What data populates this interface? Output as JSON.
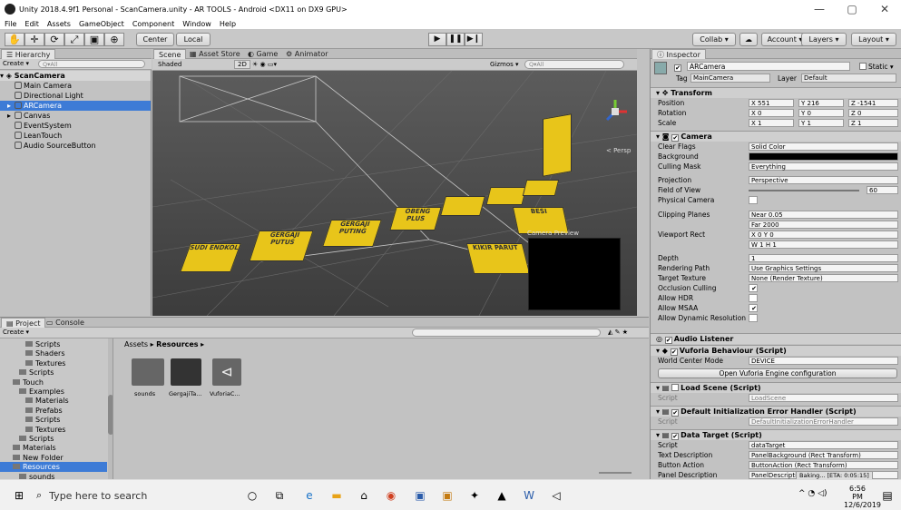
{
  "window": {
    "title": "Unity 2018.4.9f1 Personal - ScanCamera.unity - AR TOOLS - Android <DX11 on DX9 GPU>",
    "min": "—",
    "max": "▢",
    "close": "✕"
  },
  "menu": [
    "File",
    "Edit",
    "Assets",
    "GameObject",
    "Component",
    "Window",
    "Help"
  ],
  "toolbar": {
    "center": "Center",
    "local": "Local",
    "collab": "Collab ▾",
    "account": "Account ▾",
    "layers": "Layers ▾",
    "layout": "Layout ▾"
  },
  "hierarchy": {
    "tab": "Hierarchy",
    "create": "Create ▾",
    "search_placeholder": "Q▾All",
    "scene": "ScanCamera",
    "items": [
      {
        "label": "Main Camera",
        "indent": 2,
        "selected": false,
        "arrow": ""
      },
      {
        "label": "Directional Light",
        "indent": 2,
        "selected": false,
        "arrow": ""
      },
      {
        "label": "ARCamera",
        "indent": 2,
        "selected": true,
        "arrow": "▸"
      },
      {
        "label": "Canvas",
        "indent": 2,
        "selected": false,
        "arrow": "▸"
      },
      {
        "label": "EventSystem",
        "indent": 2,
        "selected": false,
        "arrow": ""
      },
      {
        "label": "LeanTouch",
        "indent": 2,
        "selected": false,
        "arrow": ""
      },
      {
        "label": "Audio SourceButton",
        "indent": 2,
        "selected": false,
        "arrow": ""
      }
    ]
  },
  "scene": {
    "tabs": [
      "Scene",
      "Asset Store",
      "Game",
      "Animator"
    ],
    "shaded": "Shaded",
    "mode2d": "2D",
    "gizmos": "Gizmos ▾",
    "search_placeholder": "Q▾All",
    "persp": "< Persp",
    "camera_preview": "Camera Preview",
    "cards": [
      "GERGAJI PUTUS",
      "GERGAJI PUTING",
      "OBENG PLUS",
      "KIKIR PARUT",
      "BESI",
      "SUDI ENDKOL"
    ]
  },
  "inspector": {
    "tab": "Inspector",
    "object_name": "ARCamera",
    "static": "Static ▾",
    "tag_label": "Tag",
    "tag": "MainCamera",
    "layer_label": "Layer",
    "layer": "Default",
    "transform": {
      "title": "Transform",
      "position": {
        "label": "Position",
        "x": "551",
        "y": "216",
        "z": "-1541"
      },
      "rotation": {
        "label": "Rotation",
        "x": "0",
        "y": "0",
        "z": "0"
      },
      "scale": {
        "label": "Scale",
        "x": "1",
        "y": "1",
        "z": "1"
      }
    },
    "camera": {
      "title": "Camera",
      "rows": [
        {
          "label": "Clear Flags",
          "value": "Solid Color"
        },
        {
          "label": "Background",
          "value": ""
        },
        {
          "label": "Culling Mask",
          "value": "Everything"
        },
        {
          "label": "Projection",
          "value": "Perspective"
        },
        {
          "label": "Field of View",
          "value": "60"
        },
        {
          "label": "Physical Camera",
          "value": ""
        },
        {
          "label": "Clipping Planes",
          "value": "Near  0.05"
        },
        {
          "label": "",
          "value": "Far   2000"
        },
        {
          "label": "Viewport Rect",
          "value": "X 0       Y 0"
        },
        {
          "label": "",
          "value": "W 1       H 1"
        },
        {
          "label": "Depth",
          "value": "1"
        },
        {
          "label": "Rendering Path",
          "value": "Use Graphics Settings"
        },
        {
          "label": "Target Texture",
          "value": "None (Render Texture)"
        },
        {
          "label": "Occlusion Culling",
          "value": "✔"
        },
        {
          "label": "Allow HDR",
          "value": ""
        },
        {
          "label": "Allow MSAA",
          "value": "✔"
        },
        {
          "label": "Allow Dynamic Resolution",
          "value": ""
        }
      ]
    },
    "audio_listener": "Audio Listener",
    "vuforia": {
      "title": "Vuforia Behaviour (Script)",
      "world_center_label": "World Center Mode",
      "world_center": "DEVICE",
      "open_btn": "Open Vuforia Engine configuration"
    },
    "load_scene": {
      "title": "Load Scene (Script)",
      "script_label": "Script",
      "script": "LoadScene"
    },
    "default_init": {
      "title": "Default Initialization Error Handler (Script)",
      "script_label": "Script",
      "script": "DefaultInitializationErrorHandler"
    },
    "data_target": {
      "title": "Data Target (Script)",
      "rows": [
        {
          "label": "Script",
          "value": "dataTarget"
        },
        {
          "label": "Text Description",
          "value": "PanelBackground (Rect Transform)"
        },
        {
          "label": "Button Action",
          "value": "ButtonAction (Rect Transform)"
        },
        {
          "label": "Panel Description",
          "value": "PanelDescription (Rect Transform)"
        }
      ]
    },
    "baking": "Baking... [ETA: 0:05:15]"
  },
  "project": {
    "tabs": [
      "Project",
      "Console"
    ],
    "create": "Create ▾",
    "breadcrumb": [
      "Assets",
      "Resources"
    ],
    "tree": [
      {
        "label": "Scripts",
        "indent": 4
      },
      {
        "label": "Shaders",
        "indent": 4
      },
      {
        "label": "Textures",
        "indent": 4
      },
      {
        "label": "Scripts",
        "indent": 3
      },
      {
        "label": "Touch",
        "indent": 2
      },
      {
        "label": "Examples",
        "indent": 3
      },
      {
        "label": "Materials",
        "indent": 4
      },
      {
        "label": "Prefabs",
        "indent": 4
      },
      {
        "label": "Scripts",
        "indent": 4
      },
      {
        "label": "Textures",
        "indent": 4
      },
      {
        "label": "Scripts",
        "indent": 3
      },
      {
        "label": "Materials",
        "indent": 2
      },
      {
        "label": "New Folder",
        "indent": 2
      },
      {
        "label": "Resources",
        "indent": 2
      },
      {
        "label": "sounds",
        "indent": 3
      }
    ],
    "assets": [
      "sounds",
      "GergajiTa...",
      "VuforiaC..."
    ]
  },
  "taskbar": {
    "search_placeholder": "Type here to search",
    "time": "6:56 PM",
    "date": "12/6/2019"
  }
}
